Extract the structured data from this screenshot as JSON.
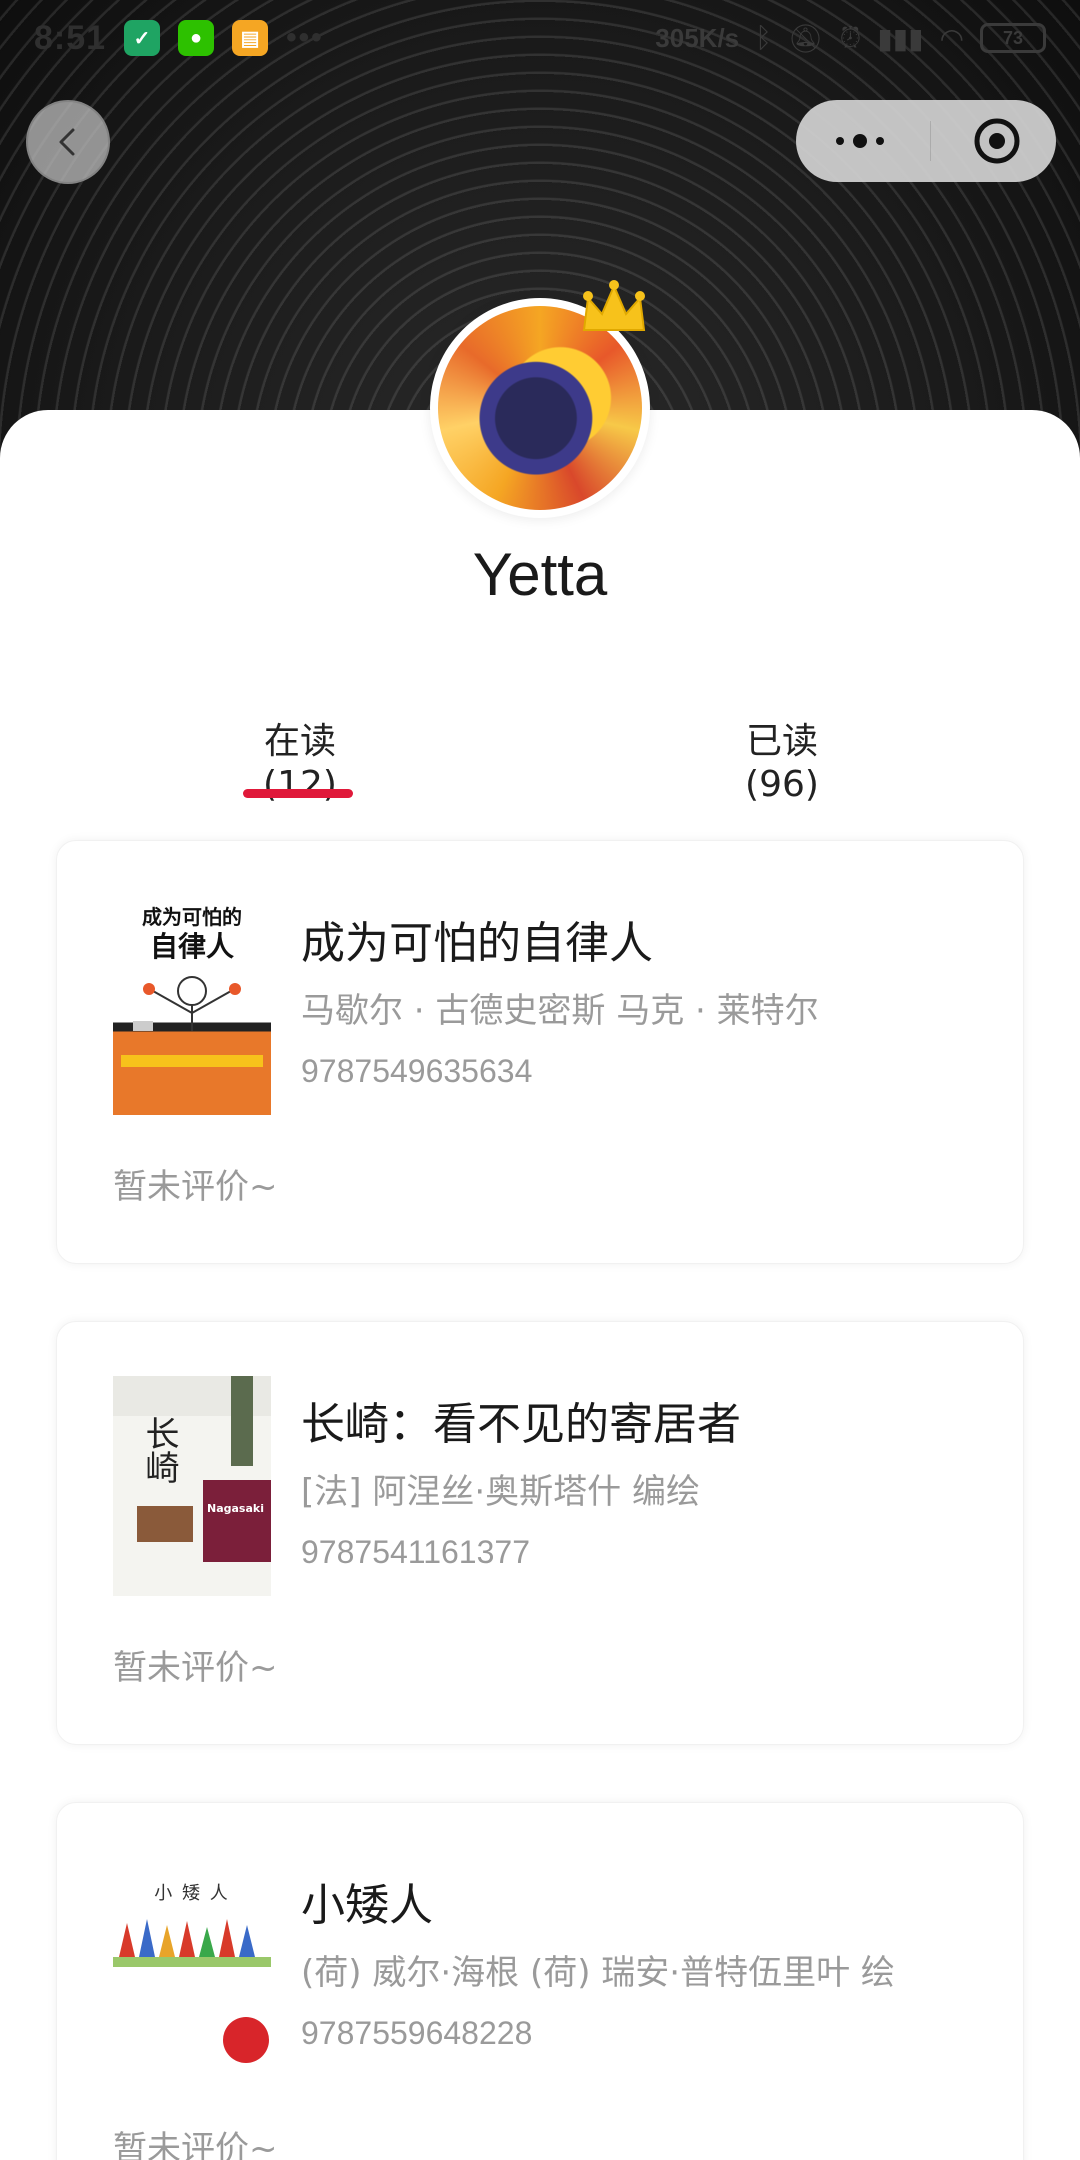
{
  "status_bar": {
    "time": "8:51",
    "more": "•••",
    "net_speed": "305K/s",
    "battery": "73",
    "app_icons": [
      "shield-app-icon",
      "wechat-icon",
      "message-app-icon"
    ]
  },
  "profile": {
    "name": "Yetta"
  },
  "tabs": [
    {
      "label": "在读(12)",
      "active": true
    },
    {
      "label": "已读(96)",
      "active": false
    }
  ],
  "books": [
    {
      "title": "成为可怕的自律人",
      "author": "马歇尔 · 古德史密斯 马克 · 莱特尔",
      "isbn": "9787549635634",
      "review": "暂未评价~",
      "cover_title": "成为可怕的",
      "cover_title2": "自律人"
    },
    {
      "title": "长崎：看不见的寄居者",
      "author": "[法] 阿涅丝·奥斯塔什 编绘",
      "isbn": "9787541161377",
      "review": "暂未评价~",
      "cover_title": "长崎",
      "cover_sub": "Nagasaki"
    },
    {
      "title": "小矮人",
      "author": "(荷) 威尔·海根 (荷) 瑞安·普特伍里叶 绘",
      "isbn": "9787559648228",
      "review": "暂未评价~",
      "cover_title": "小  矮  人"
    }
  ],
  "colors": {
    "accent": "#e0193a",
    "text_primary": "#1a1a1a",
    "text_secondary": "#9a9a9a"
  }
}
